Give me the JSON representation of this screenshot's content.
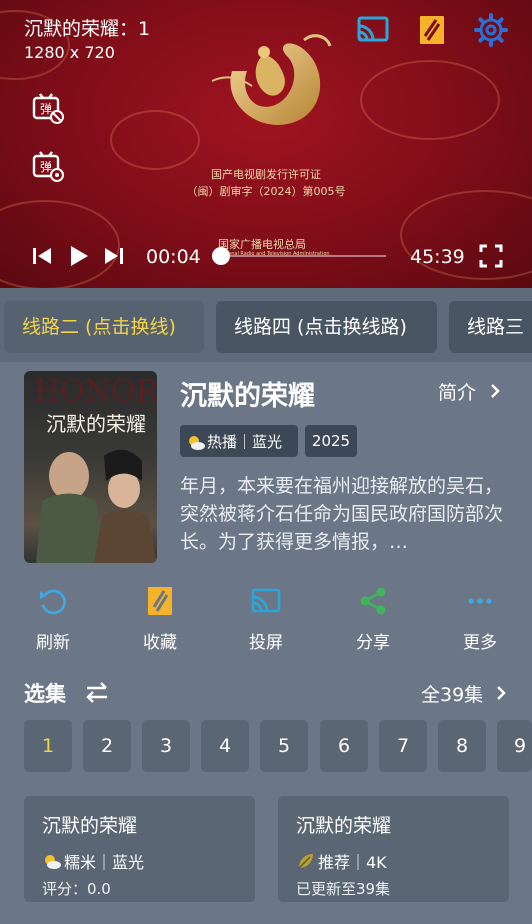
{
  "player": {
    "title": "沉默的荣耀：1",
    "resolution": "1280 x 720",
    "license_line1": "国产电视剧发行许可证",
    "license_line2": "（闽）剧审字（2024）第005号",
    "broadcaster": "国家广播电视总局",
    "broadcaster_en": "National Radio and Television Administration",
    "current_time": "00:04",
    "total_time": "45:39",
    "progress": 0.0015,
    "accent_color": "#2ba6d9"
  },
  "lines": [
    "线路二 (点击换线)",
    "线路四 (点击换线路)",
    "线路三"
  ],
  "info": {
    "poster_text": "沉默的荣耀",
    "title": "沉默的荣耀",
    "intro_label": "简介",
    "tag": "热播｜蓝光",
    "year": "2025",
    "synopsis": "年月，本来要在福州迎接解放的吴石，突然被蒋介石任命为国民政府国防部次长。为了获得更多情报，…"
  },
  "actions": [
    {
      "label": "刷新",
      "icon": "refresh-icon"
    },
    {
      "label": "收藏",
      "icon": "bookmark-icon"
    },
    {
      "label": "投屏",
      "icon": "cast-icon"
    },
    {
      "label": "分享",
      "icon": "share-icon"
    },
    {
      "label": "更多",
      "icon": "more-icon"
    }
  ],
  "episodes": {
    "heading": "选集",
    "total": "全39集",
    "items": [
      "1",
      "2",
      "3",
      "4",
      "5",
      "6",
      "7",
      "8",
      "9"
    ],
    "selected": "1"
  },
  "recommendations": [
    {
      "title": "沉默的荣耀",
      "tag": "糯米｜蓝光",
      "sub": "评分：0.0"
    },
    {
      "title": "沉默的荣耀",
      "tag": "推荐｜4K",
      "sub": "已更新至39集"
    }
  ],
  "colors": {
    "selected": "#f2d34a",
    "refresh": "#3fa9e8",
    "bookmark": "#f5b32a",
    "cast": "#2ba6d9",
    "share": "#3fb65b",
    "more": "#3fa9e8"
  }
}
